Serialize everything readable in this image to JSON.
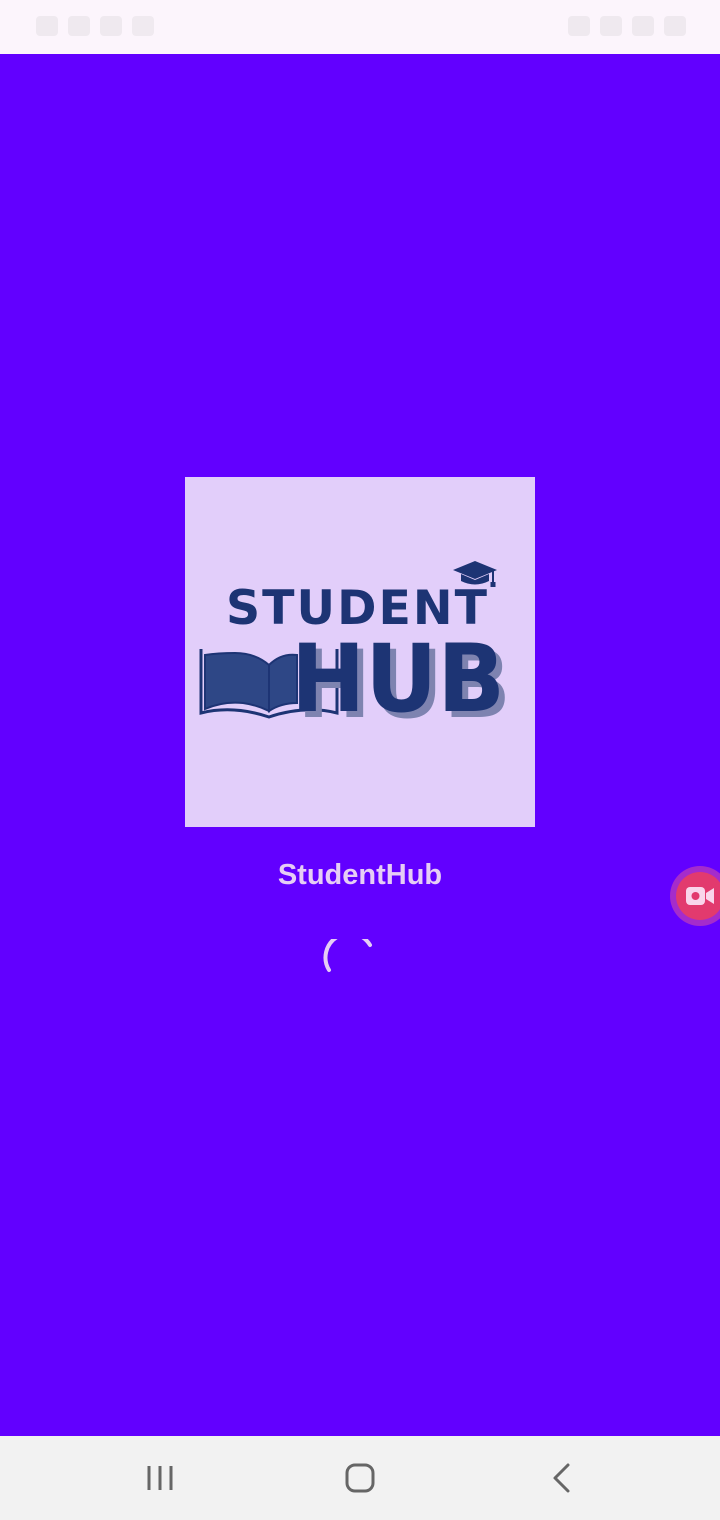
{
  "app": {
    "name": "StudentHub",
    "background_color": "#6200FF",
    "accent_color": "#E6CDF5"
  },
  "logo": {
    "line1": "STUDENT",
    "line2": "HUB",
    "text_color": "#1D3474",
    "background_color": "#E2CEFA",
    "icons": [
      "open-book-icon",
      "graduation-cap-icon"
    ]
  },
  "loading": {
    "indicator": "spinner-icon"
  },
  "overlay": {
    "icon": "video-camera-icon"
  },
  "navigation": {
    "buttons": [
      "recent-apps-icon",
      "home-icon",
      "back-icon"
    ]
  }
}
